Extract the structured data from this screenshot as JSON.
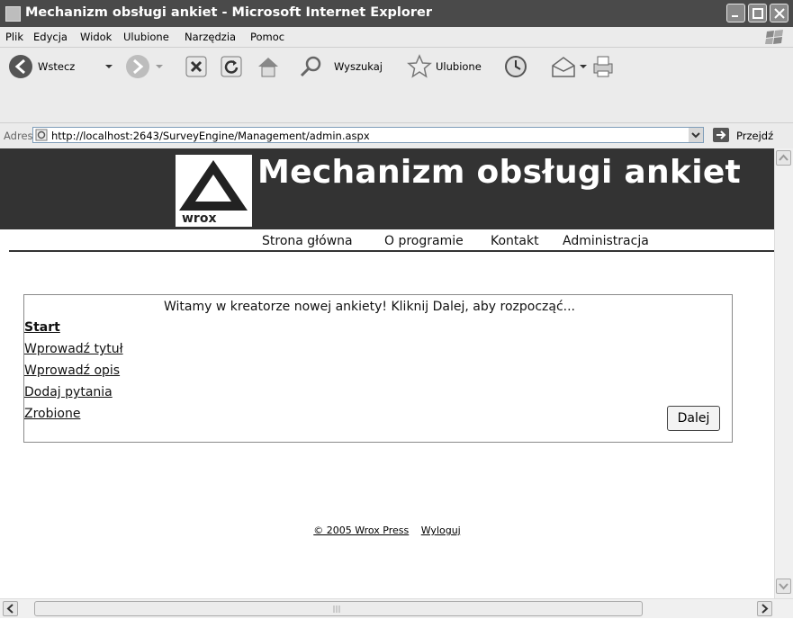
{
  "window": {
    "title": "Mechanizm obsługi ankiet - Microsoft Internet Explorer"
  },
  "menu": {
    "items": [
      "Plik",
      "Edycja",
      "Widok",
      "Ulubione",
      "Narzędzia",
      "Pomoc"
    ]
  },
  "toolbar": {
    "back_label": "Wstecz",
    "search_label": "Wyszukaj",
    "favorites_label": "Ulubione"
  },
  "address": {
    "label": "Adres",
    "url": "http://localhost:2643/SurveyEngine/Management/admin.aspx",
    "go_label": "Przejdź"
  },
  "site": {
    "logo_text": "wrox",
    "title": "Mechanizm obsługi ankiet",
    "nav": [
      "Strona główna",
      "O programie",
      "Kontakt",
      "Administracja"
    ]
  },
  "wizard": {
    "welcome": "Witamy w kreatorze nowej ankiety! Kliknij Dalej, aby rozpocząć...",
    "steps": [
      "Start",
      "Wprowadź tytuł",
      "Wprowadź opis",
      "Dodaj pytania",
      "Zrobione"
    ],
    "next_label": "Dalej"
  },
  "footer": {
    "copyright": "© 2005 Wrox Press",
    "logout": "Wyloguj"
  },
  "colors": {
    "header_bg": "#333333",
    "titlebar_bg": "#4a4a4a"
  }
}
